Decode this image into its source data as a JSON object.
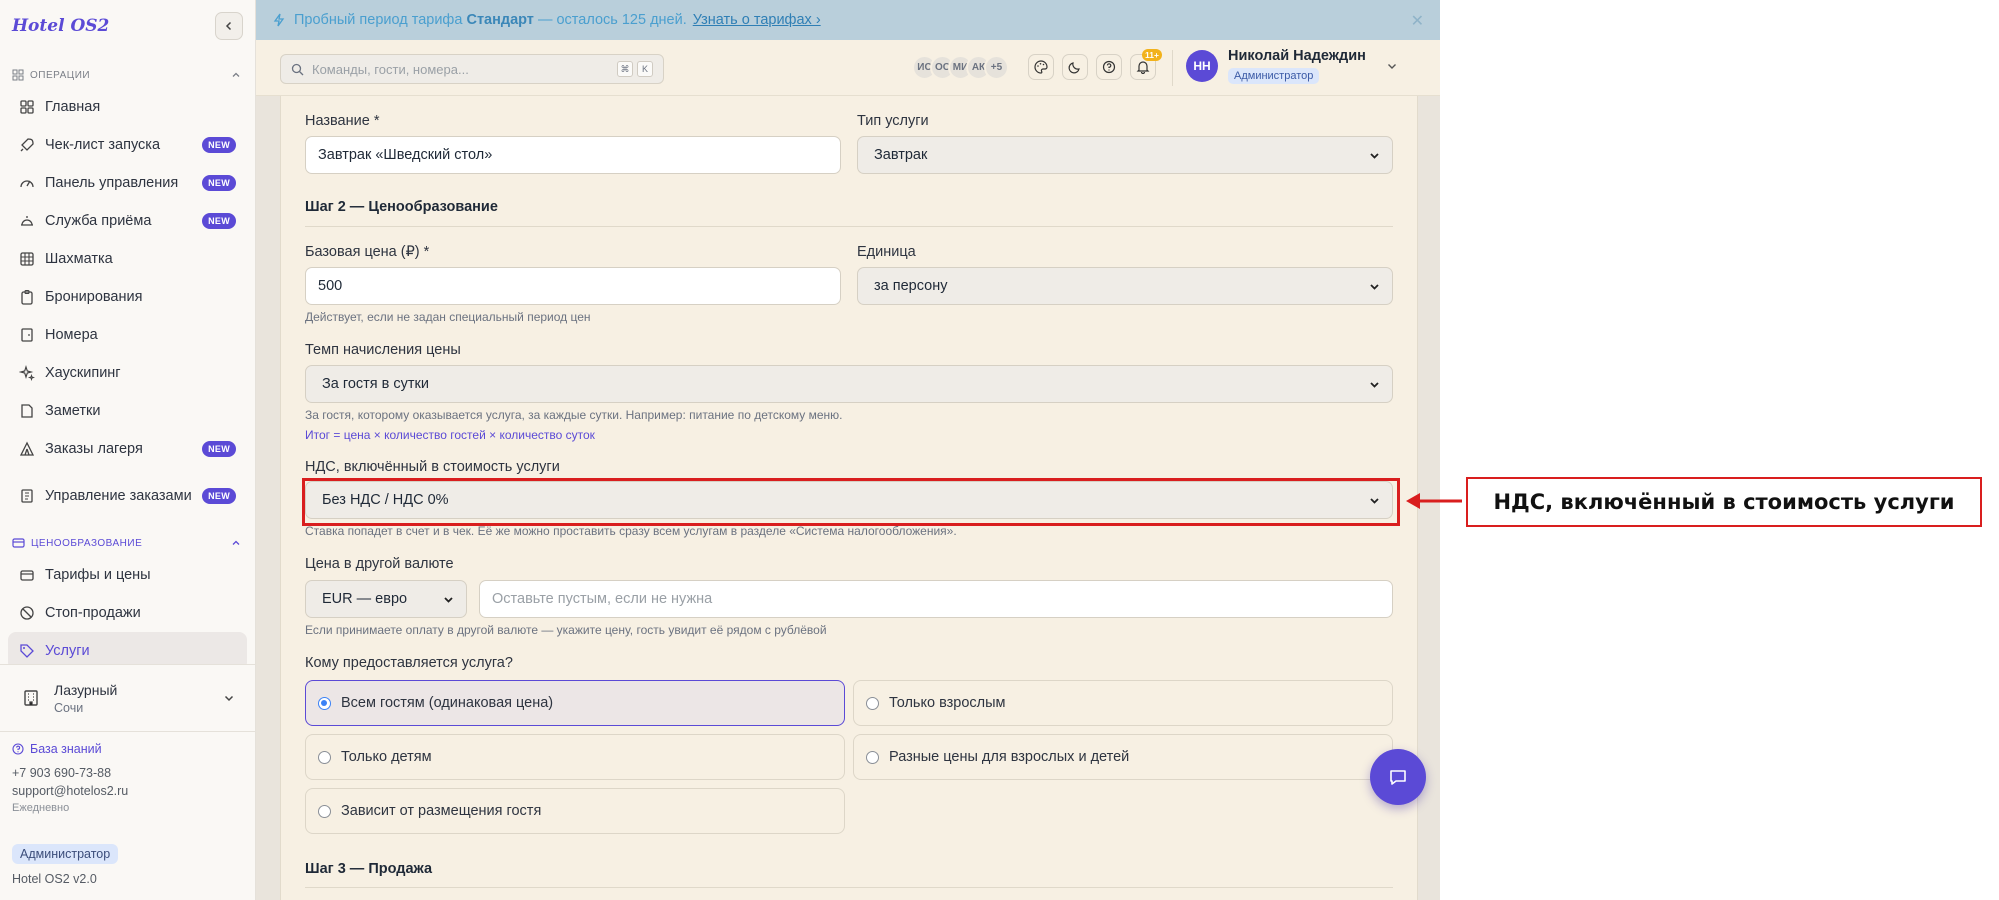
{
  "brand": "Hotel OS2",
  "sidebar": {
    "sections": [
      {
        "title": "ОПЕРАЦИИ"
      },
      {
        "title": "ЦЕНООБРАЗОВАНИЕ"
      }
    ],
    "operations": [
      {
        "label": "Главная",
        "icon": "grid-icon",
        "badge": ""
      },
      {
        "label": "Чек-лист запуска",
        "icon": "rocket-icon",
        "badge": "NEW"
      },
      {
        "label": "Панель управления",
        "icon": "gauge-icon",
        "badge": "NEW"
      },
      {
        "label": "Служба приёма",
        "icon": "bell-desk-icon",
        "badge": "NEW"
      },
      {
        "label": "Шахматка",
        "icon": "table-grid-icon",
        "badge": ""
      },
      {
        "label": "Бронирования",
        "icon": "clipboard-icon",
        "badge": ""
      },
      {
        "label": "Номера",
        "icon": "door-icon",
        "badge": ""
      },
      {
        "label": "Хаускипинг",
        "icon": "sparkles-icon",
        "badge": ""
      },
      {
        "label": "Заметки",
        "icon": "note-icon",
        "badge": ""
      },
      {
        "label": "Заказы лагеря",
        "icon": "tent-icon",
        "badge": "NEW"
      },
      {
        "label": "Управление заказами",
        "icon": "receipt-icon",
        "badge": "NEW"
      }
    ],
    "pricing": [
      {
        "label": "Тарифы и цены",
        "icon": "wallet-icon"
      },
      {
        "label": "Стоп-продажи",
        "icon": "ban-icon"
      },
      {
        "label": "Услуги",
        "icon": "tag-icon"
      }
    ],
    "hotel": {
      "name": "Лазурный",
      "city": "Сочи"
    },
    "support": {
      "kb": "База знаний",
      "phone": "+7 903 690-73-88",
      "email": "support@hotelos2.ru",
      "hours": "Ежедневно"
    },
    "role": "Администратор",
    "version": "Hotel OS2 v2.0"
  },
  "banner": {
    "prefix": "Пробный период тарифа",
    "plan": "Стандарт",
    "suffix": "— осталось 125 дней.",
    "link": "Узнать о тарифах ›"
  },
  "topbar": {
    "search_placeholder": "Команды, гости, номера...",
    "kbd": [
      "⌘",
      "K"
    ],
    "avatars": [
      "ИС",
      "ОС",
      "МИ",
      "АК",
      "+5"
    ],
    "notifications": "11+",
    "user_initials": "НН",
    "user_name": "Николай Надеждин",
    "user_role": "Администратор"
  },
  "form": {
    "name_label": "Название *",
    "name_value": "Завтрак «Шведский стол»",
    "type_label": "Тип услуги",
    "type_value": "Завтрак",
    "step2": "Шаг 2 — Ценообразование",
    "base_label": "Базовая цена (₽) *",
    "base_value": "500",
    "base_hint": "Действует, если не задан специальный период цен",
    "unit_label": "Единица",
    "unit_value": "за персону",
    "rate_label": "Темп начисления цены",
    "rate_value": "За гостя в сутки",
    "rate_hint": "За гостя, которому оказывается услуга, за каждые сутки. Например: питание по детскому меню.",
    "rate_formula": "Итог = цена × количество гостей × количество суток",
    "vat_label": "НДС, включённый в стоимость услуги",
    "vat_value": "Без НДС / НДС 0%",
    "vat_hint": "Ставка попадет в счет и в чек. Её же можно проставить сразу всем услугам в разделе «Система налогообложения».",
    "currency_label": "Цена в другой валюте",
    "currency_value": "EUR — евро",
    "currency_placeholder": "Оставьте пустым, если не нужна",
    "currency_hint": "Если принимаете оплату в другой валюте — укажите цену, гость увидит её рядом с рублёвой",
    "audience_label": "Кому предоставляется услуга?",
    "audience_options": [
      {
        "label": "Всем гостям (одинаковая цена)",
        "selected": true
      },
      {
        "label": "Только взрослым",
        "selected": false
      },
      {
        "label": "Только детям",
        "selected": false
      },
      {
        "label": "Разные цены для взрослых и детей",
        "selected": false
      },
      {
        "label": "Зависит от размещения гостя",
        "selected": false
      }
    ],
    "step3": "Шаг 3 — Продажа"
  },
  "annotation": {
    "label": "НДС, включённый в стоимость услуги",
    "color": "#d91e1e"
  }
}
